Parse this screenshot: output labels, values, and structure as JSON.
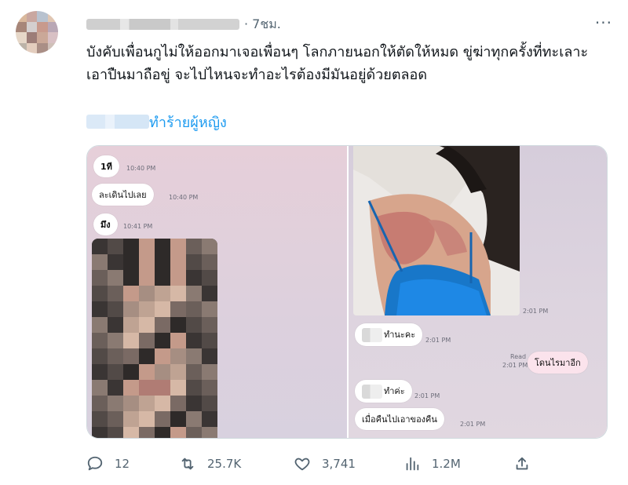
{
  "tweet": {
    "time": "· 7ชม.",
    "more": "···",
    "text": "บังคับเพื่อนกูไม่ให้ออกมาเจอเพื่อนๆ โลกภายนอกให้ตัดให้หมด ขู่ฆ่าทุกครั้งที่ทะเลาะ เอาปืนมาถือขู่ จะไปไหนจะทำอะไรต้องมีมันอยู่ด้วยตลอด",
    "tag": "ทำร้ายผู้หญิง"
  },
  "media": {
    "left_chat": [
      {
        "text": "1ที",
        "time": "10:40 PM"
      },
      {
        "text": "ละเดินไปเลย",
        "time": "10:40 PM"
      },
      {
        "text": "มึง",
        "time": "10:41 PM"
      }
    ],
    "right_chat": {
      "photo_time": "2:01 PM",
      "m1": {
        "text": "ทำนะคะ",
        "time": "2:01 PM"
      },
      "m2": {
        "read": "Read",
        "time": "2:01 PM",
        "text": "โดนไรมาอีก"
      },
      "m3": {
        "text": "ทำค่ะ",
        "time": "2:01 PM"
      },
      "m4": {
        "text": "เมื่อคืนไปเอาของคืน",
        "time": "2:01 PM"
      }
    }
  },
  "actions": {
    "reply_count": "12",
    "retweet_count": "25.7K",
    "like_count": "3,741",
    "view_count": "1.2M"
  },
  "colors": {
    "accent": "#1d9bf0",
    "muted": "#536471"
  }
}
